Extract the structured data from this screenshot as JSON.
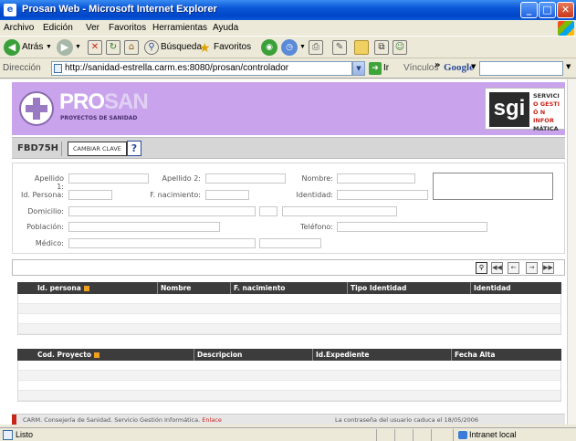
{
  "window": {
    "title": "Prosan Web - Microsoft Internet Explorer"
  },
  "menu": [
    "Archivo",
    "Edición",
    "Ver",
    "Favoritos",
    "Herramientas",
    "Ayuda"
  ],
  "toolbar": {
    "back": "Atrás",
    "search": "Búsqueda",
    "favorites": "Favoritos"
  },
  "address": {
    "label": "Dirección",
    "url": "http://sanidad-estrella.carm.es:8080/prosan/controlador",
    "go": "Ir",
    "links": "Vínculos",
    "google": "Google"
  },
  "banner": {
    "title_a": "PRO",
    "title_b": "SAN",
    "subtitle": "PROYECTOS DE SANIDAD",
    "sgi_mark": "sgi",
    "sgi_lines": [
      "SERVICI",
      "O GESTI",
      "Ó N INFOR",
      "MÁTICA"
    ]
  },
  "user": {
    "code": "FBD75H",
    "change_key": "CAMBIAR CLAVE",
    "help": "?"
  },
  "form": {
    "apellido1": "Apellido 1:",
    "apellido2": "Apellido 2:",
    "nombre": "Nombre:",
    "id_persona": "Id. Persona:",
    "f_nacimiento": "F. nacimiento:",
    "identidad": "Identidad:",
    "domicilio": "Domicilio:",
    "poblacion": "Población:",
    "telefono": "Teléfono:",
    "medico": "Médico:"
  },
  "grid_nav": [
    "search",
    "first",
    "prev",
    "next",
    "last"
  ],
  "persons_table": {
    "headers": [
      "Id. persona",
      "Nombre",
      "F. nacimiento",
      "Tipo Identidad",
      "Identidad"
    ]
  },
  "projects_table": {
    "headers": [
      "Cod. Proyecto",
      "Descripcion",
      "Id.Expediente",
      "Fecha Alta"
    ]
  },
  "footer": {
    "left": "CARM. Consejería de Sanidad. Servicio Gestión Informática.",
    "link": "Enlace",
    "right": "La contraseña del usuario caduca el 18/05/2006"
  },
  "status": {
    "text": "Listo",
    "zone": "Intranet local"
  }
}
